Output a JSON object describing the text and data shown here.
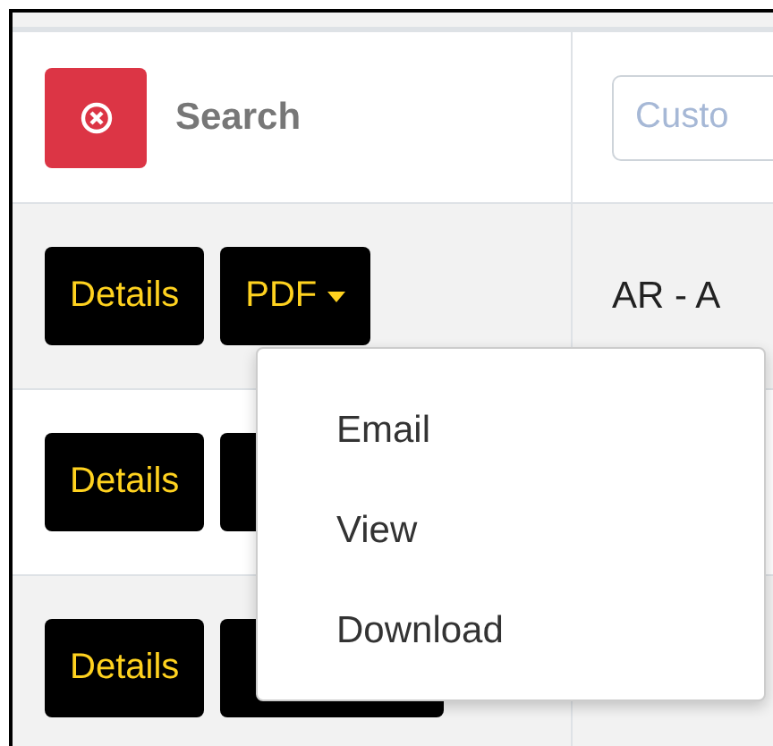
{
  "header": {
    "search_label": "Search",
    "filter_placeholder": "Custo"
  },
  "rows": [
    {
      "actions": [
        {
          "kind": "button",
          "label": "Details"
        },
        {
          "kind": "dropdown",
          "label": "PDF"
        }
      ],
      "cell": "AR - A"
    },
    {
      "actions": [
        {
          "kind": "button",
          "label": "Details"
        },
        {
          "kind": "covered"
        }
      ]
    },
    {
      "actions": [
        {
          "kind": "button",
          "label": "Details"
        },
        {
          "kind": "covered"
        }
      ]
    }
  ],
  "menu": {
    "items": [
      "Email",
      "View",
      "Download"
    ]
  }
}
